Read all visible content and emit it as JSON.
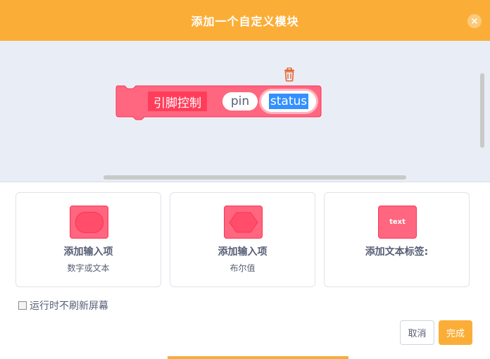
{
  "dialog": {
    "title": "添加一个自定义模块",
    "close_label": "×"
  },
  "workspace": {
    "block": {
      "label": "引脚控制",
      "inputs": [
        {
          "name": "pin"
        },
        {
          "name": "status",
          "selected": true
        }
      ]
    }
  },
  "options": [
    {
      "title": "添加输入项",
      "subtitle": "数字或文本",
      "shape": "rounded"
    },
    {
      "title": "添加输入项",
      "subtitle": "布尔值",
      "shape": "hexagon"
    },
    {
      "title": "添加文本标签:",
      "subtitle": "",
      "shape": "text",
      "swatch_text": "text"
    }
  ],
  "run_without_refresh": {
    "label": "运行时不刷新屏幕",
    "checked": false
  },
  "buttons": {
    "cancel": "取消",
    "ok": "完成"
  },
  "colors": {
    "header": "#fbae37",
    "block": "#ff6680",
    "block_label": "#ff3d5a",
    "selection": "#3390ff",
    "text": "#575e75"
  }
}
